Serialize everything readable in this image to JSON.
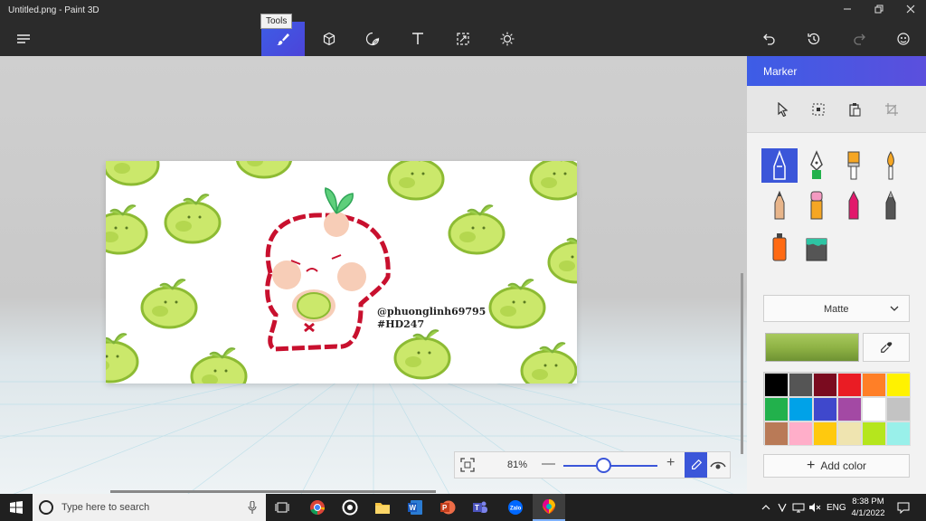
{
  "window": {
    "title": "Untitled.png - Paint 3D",
    "minimize_icon": "minimize-icon",
    "maximize_icon": "restore-icon",
    "close_icon": "close-icon"
  },
  "toolbar": {
    "tooltip": "Tools",
    "tools": [
      {
        "name": "brushes",
        "icon": "brush-icon",
        "active": true
      },
      {
        "name": "3d-shapes",
        "icon": "cube-icon"
      },
      {
        "name": "stickers",
        "icon": "sticker-icon"
      },
      {
        "name": "text",
        "icon": "text-icon"
      },
      {
        "name": "effects",
        "icon": "effects-icon"
      },
      {
        "name": "canvas",
        "icon": "canvas-icon"
      }
    ],
    "right_actions": [
      "undo-icon",
      "history-icon",
      "redo-icon",
      "remix-icon"
    ]
  },
  "canvas": {
    "watermark_line1": "@phuonglinh69795",
    "watermark_line2": "#HD247"
  },
  "zoom": {
    "percent": "81%",
    "level": 0.42,
    "minus": "—",
    "plus": "+"
  },
  "panel": {
    "title": "Marker",
    "finish": "Matte",
    "add_color": "Add color",
    "current_color": "#8fb345",
    "palette": [
      "#000000",
      "#555555",
      "#7a0b1f",
      "#ea1c24",
      "#ff7f27",
      "#fff200",
      "#22b14c",
      "#00a2e8",
      "#3f48cc",
      "#a349a4",
      "#ffffff",
      "#c3c3c3",
      "#b97a57",
      "#ffaec9",
      "#ffc90e",
      "#efe4b0",
      "#b5e61d",
      "#99f0ea"
    ]
  },
  "taskbar": {
    "search_placeholder": "Type here to search",
    "language": "ENG",
    "time": "8:38 PM",
    "date": "4/1/2022"
  }
}
